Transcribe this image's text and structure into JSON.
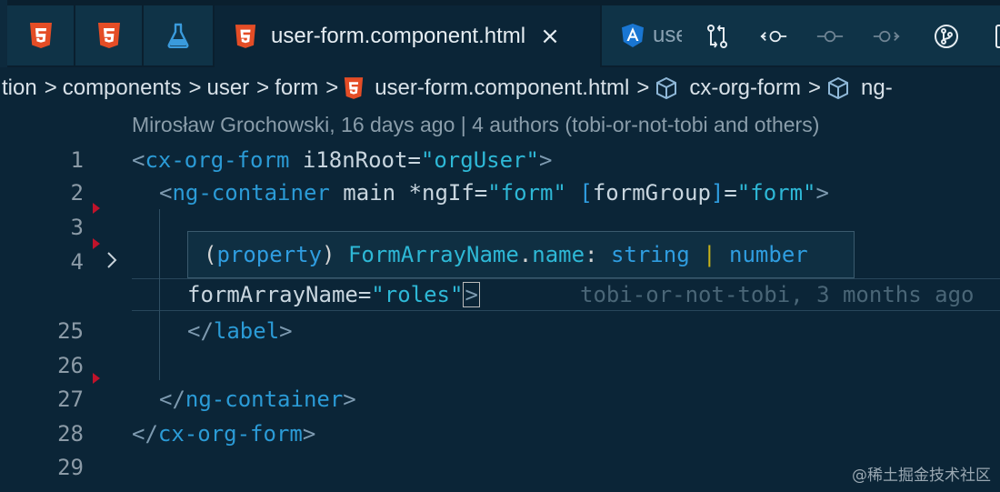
{
  "tabs": [
    {
      "icon": "html5-icon",
      "label": ""
    },
    {
      "icon": "html5-icon",
      "label": ""
    },
    {
      "icon": "flask-icon",
      "label": ""
    },
    {
      "icon": "html5-icon",
      "label": "user-form.component.html",
      "active": true,
      "close": "×"
    },
    {
      "icon": "angular-icon",
      "label": "user-form.component.ts"
    }
  ],
  "toolbar_icons": [
    "compare-changes-icon",
    "previous-change-icon",
    "commit-icon",
    "next-change-icon",
    "git-graph-icon",
    "split-editor-icon"
  ],
  "breadcrumb": {
    "segments": [
      "tion",
      "components",
      "user",
      "form",
      "user-form.component.html",
      "cx-org-form",
      "ng-"
    ],
    "separator": ">"
  },
  "codelens": "Mirosław Grochowski, 16 days ago | 4 authors (tobi-or-not-tobi and others)",
  "line_numbers": [
    "1",
    "2",
    "3",
    "4",
    "25",
    "26",
    "27",
    "28",
    "29"
  ],
  "code": {
    "l1": {
      "open": "<",
      "tag": "cx-org-form",
      "attr": " i18nRoot=",
      "val": "\"orgUser\"",
      "close": ">"
    },
    "l2": {
      "open": "<",
      "tag": "ng-container",
      "attr": " main *ngIf=",
      "val": "\"form\"",
      "sp": " ",
      "b1": "[",
      "attr2": "formGroup",
      "b2": "]",
      "eq": "=",
      "val2": "\"form\"",
      "close": ">"
    },
    "l4b": {
      "attr": "formArrayName=",
      "val": "\"roles\"",
      "close": ">"
    },
    "l25": {
      "open": "</",
      "tag": "label",
      "close": ">"
    },
    "l27": {
      "open": "</",
      "tag": "ng-container",
      "close": ">"
    },
    "l28": {
      "open": "</",
      "tag": "cx-org-form",
      "close": ">"
    }
  },
  "hover": {
    "p1": "(",
    "p2": "property",
    "p3": ") ",
    "p4": "FormArrayName",
    "p5": ".",
    "p6": "name",
    "p7": ": ",
    "p8": "string",
    "p9": " | ",
    "p10": "number"
  },
  "blame": "tobi-or-not-tobi, 3 months ago",
  "watermark": "@稀土掘金技术社区",
  "colors": {
    "background": "#0b2537",
    "tag": "#2b9bd6",
    "string": "#2eb8d6",
    "html5": "#e44d26",
    "angular": "#1976d2"
  }
}
